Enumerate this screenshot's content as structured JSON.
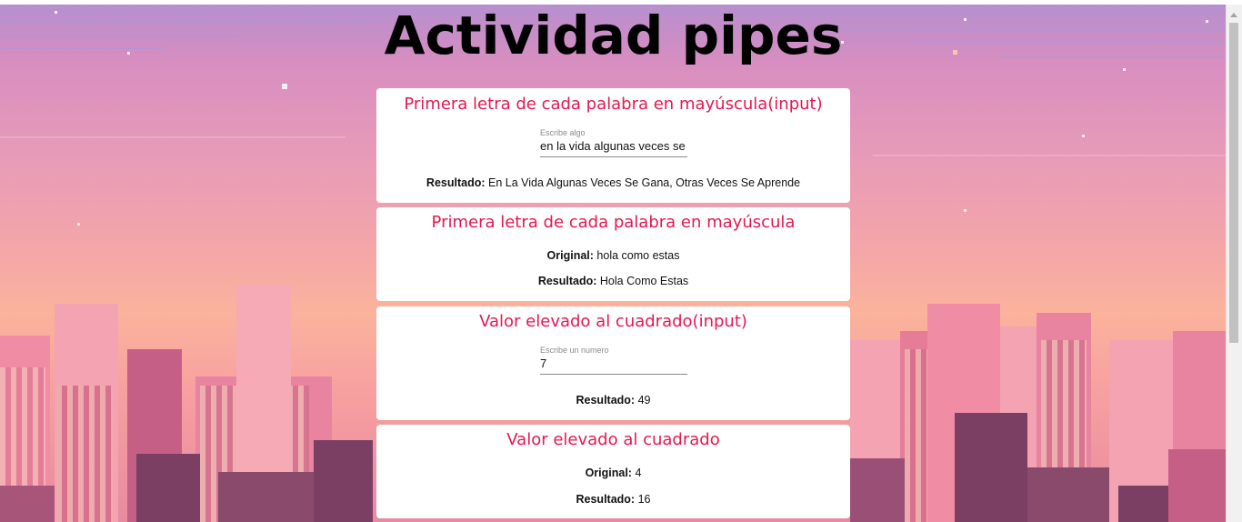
{
  "page": {
    "title": "Actividad pipes"
  },
  "cards": [
    {
      "heading": "Primera letra de cada palabra en mayúscula(input)",
      "input_placeholder_label": "Escribe algo",
      "input_value": "en la vida algunas veces se g",
      "result_label": "Resultado:",
      "result_value": "En La Vida Algunas Veces Se Gana, Otras Veces Se Aprende"
    },
    {
      "heading": "Primera letra de cada palabra en mayúscula",
      "original_label": "Original:",
      "original_value": "hola como estas",
      "result_label": "Resultado:",
      "result_value": "Hola Como Estas"
    },
    {
      "heading": "Valor elevado al cuadrado(input)",
      "input_placeholder_label": "Escribe un numero",
      "input_value": "7",
      "result_label": "Resultado:",
      "result_value": "49"
    },
    {
      "heading": "Valor elevado al cuadrado",
      "original_label": "Original:",
      "original_value": "4",
      "result_label": "Resultado:",
      "result_value": "16"
    }
  ],
  "colors": {
    "heading": "#e8174f",
    "card_bg": "#ffffff"
  }
}
